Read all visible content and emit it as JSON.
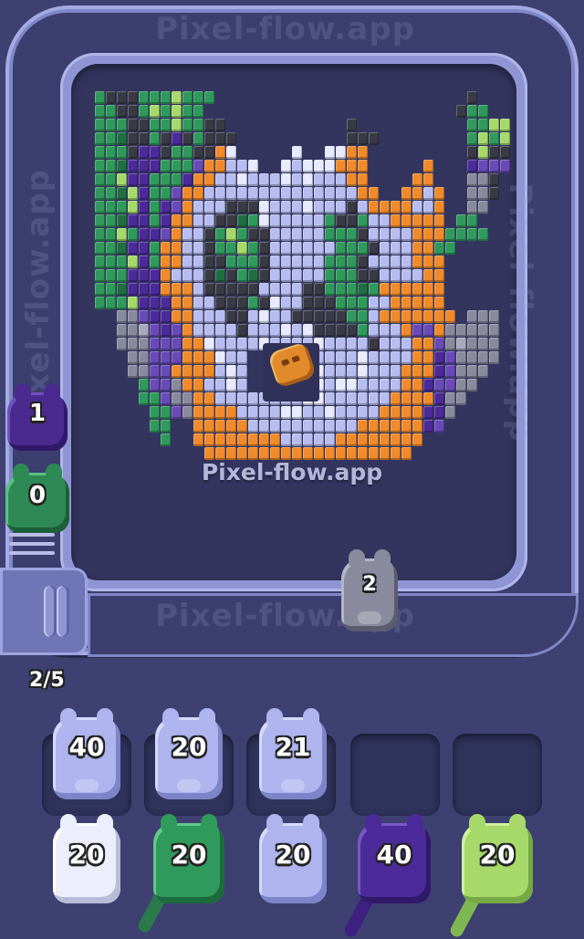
{
  "watermark": "Pixel-flow.app",
  "site_label": "Pixel-flow.app",
  "queue_counter": "2/5",
  "colors": {
    "dark": "#2c2d35",
    "black": "#3a3a44",
    "green": "#2f9a5b",
    "dgreen": "#1f6f42",
    "lime": "#a6d96a",
    "purple": "#4c2a9a",
    "violet": "#6a4ab8",
    "orange": "#f08a2a",
    "lavender": "#b7bdf0",
    "white": "#e8eaff",
    "gray": "#8a8a9e",
    "lgray": "#a9a9bd"
  },
  "queue_shooters": [
    {
      "value": "1",
      "color": "purple"
    },
    {
      "value": "0",
      "color": "green"
    }
  ],
  "track_shooter": {
    "value": "2",
    "color": "gray"
  },
  "holding_slots": [
    {
      "value": "40",
      "color": "lavender"
    },
    {
      "value": "20",
      "color": "lavender"
    },
    {
      "value": "21",
      "color": "lavender"
    },
    {
      "value": "",
      "color": "empty"
    },
    {
      "value": "",
      "color": "empty"
    }
  ],
  "supply_row": [
    {
      "value": "20",
      "color": "white"
    },
    {
      "value": "20",
      "color": "green"
    },
    {
      "value": "20",
      "color": "lavender"
    },
    {
      "value": "40",
      "color": "purple"
    },
    {
      "value": "20",
      "color": "lime"
    }
  ]
}
